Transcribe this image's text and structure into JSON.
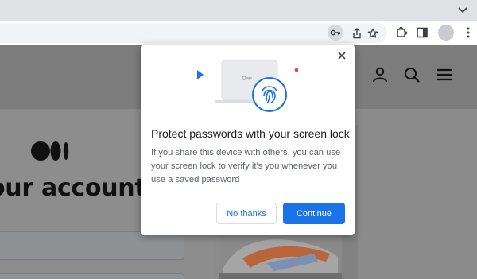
{
  "browser": {
    "icons": {
      "tab_menu": "chevron-down-icon",
      "key": "key-icon",
      "share": "share-icon",
      "bookmark": "star-icon",
      "extensions": "puzzle-icon",
      "side_panel": "side-panel-icon",
      "profile": "avatar",
      "menu": "kebab-menu-icon"
    }
  },
  "site": {
    "header_icons": [
      "user-icon",
      "search-icon",
      "hamburger-icon"
    ],
    "login_heading": "our account"
  },
  "dialog": {
    "title": "Protect passwords with your screen lock",
    "body": "If you share this device with others, you can use your screen lock to verify it's you whenever you use a saved password",
    "secondary_button": "No thanks",
    "primary_button": "Continue",
    "accent_color": "#1a73e8"
  }
}
